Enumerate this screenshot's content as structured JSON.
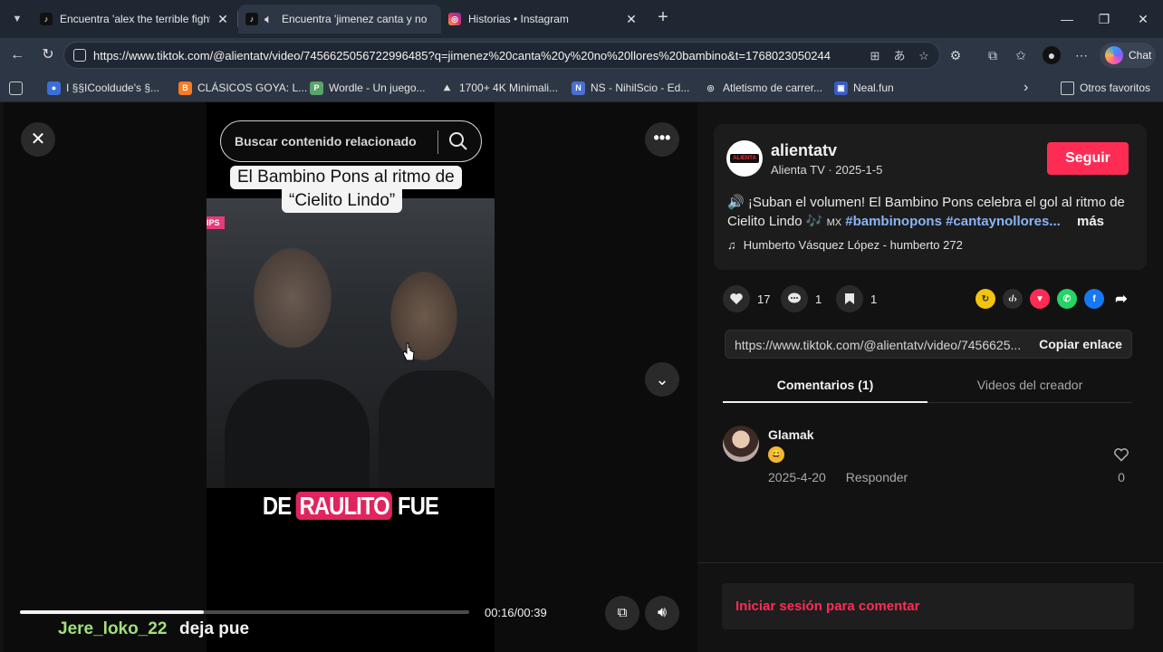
{
  "browser": {
    "tabs": [
      {
        "title": "Encuentra 'alex the terrible fight' e",
        "icon": "tiktok-icon",
        "active": false
      },
      {
        "title": "Encuentra 'jimenez canta y no",
        "icon": "tiktok-icon",
        "active": true
      },
      {
        "title": "Historias • Instagram",
        "icon": "instagram-icon",
        "active": false
      }
    ],
    "url": "https://www.tiktok.com/@alientatv/video/7456625056722996485?q=jimenez%20canta%20y%20no%20llores%20bambino&t=1768023050244",
    "chat_label": "Chat",
    "bookmarks": [
      {
        "label": "I §§ICooldude's §...",
        "icon": "bookmark-site-icon"
      },
      {
        "label": "CLÁSICOS GOYA: L...",
        "icon": "blogger-icon"
      },
      {
        "label": "Wordle - Un juego...",
        "icon": "wordle-icon"
      },
      {
        "label": "1700+ 4K Minimali...",
        "icon": "wallpaper-site-icon"
      },
      {
        "label": "NS - NihilScio - Ed...",
        "icon": "nihilscio-icon"
      },
      {
        "label": "Atletismo de carrer...",
        "icon": "atletismo-icon"
      },
      {
        "label": "Neal.fun",
        "icon": "neal-fun-icon"
      }
    ],
    "other_favorites": "Otros favoritos"
  },
  "video": {
    "search_placeholder": "Buscar contenido relacionado",
    "caption_line1": "El Bambino Pons al ritmo de",
    "caption_line2": "“Cielito Lindo”",
    "badge": "IPS",
    "overlay_before": "DE",
    "overlay_highlight": "RAULITO",
    "overlay_after": "FUE",
    "time": "00:16/00:39",
    "progress": 0.41,
    "chat_user": "Jere_loko_22",
    "chat_message": "deja pue"
  },
  "post": {
    "username": "alientatv",
    "nickname_date": "Alienta TV · 2025-1-5",
    "follow_label": "Seguir",
    "description": "🔊 ¡Suban el volumen! El Bambino Pons celebra el gol al ritmo de Cielito Lindo 🎶",
    "flag": "MX",
    "hashtags": "#bambinopons #cantaynollores...",
    "more_label": "más",
    "music": "Humberto Vásquez López - humberto 272",
    "likes": "17",
    "comments": "1",
    "saves": "1",
    "link": "https://www.tiktok.com/@alientatv/video/7456625...",
    "copy_label": "Copiar enlace",
    "tab_comments": "Comentarios (1)",
    "tab_creator": "Videos del creador"
  },
  "comment": {
    "author": "Glamak",
    "emoji": "😄",
    "date": "2025-4-20",
    "reply_label": "Responder",
    "like_count": "0"
  },
  "login_prompt": "Iniciar sesión para comentar",
  "colors": {
    "brand": "#fe2c55",
    "hashtag": "#8ab4f8",
    "chat_user": "#9fe07a"
  }
}
